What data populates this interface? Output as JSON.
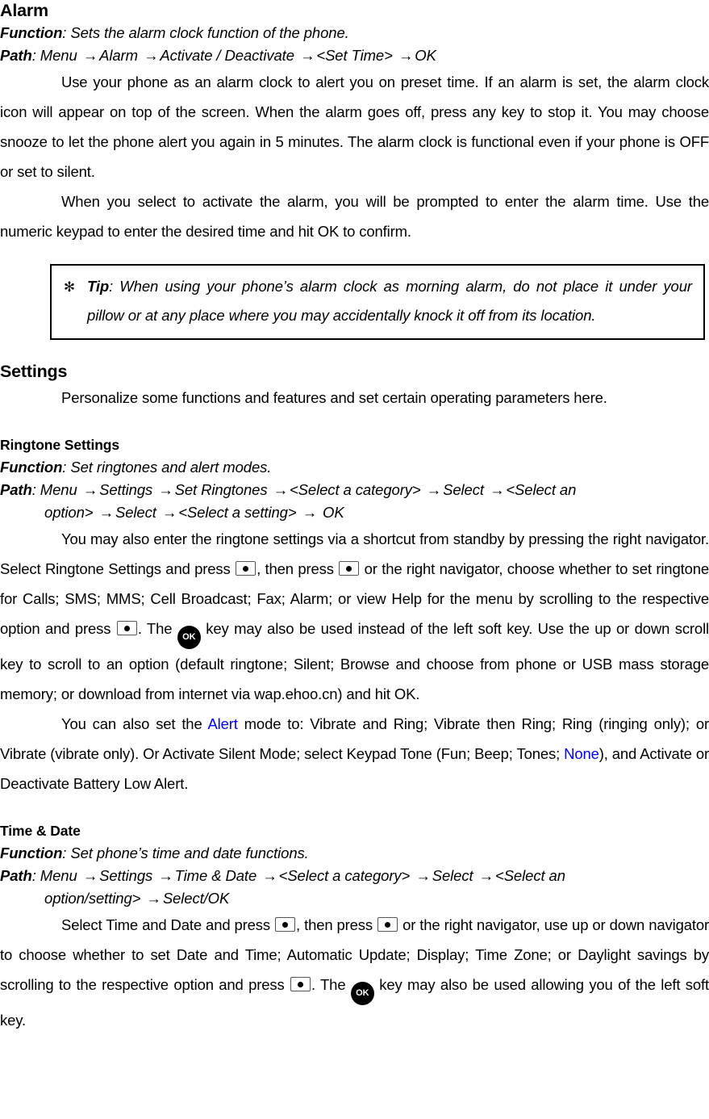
{
  "document": {
    "sections": [
      {
        "id": "alarm",
        "title": "Alarm",
        "function_label": "Function",
        "function_text": ": Sets the alarm clock function of the phone.",
        "path_label": "Path",
        "path_line1_pre": ": Menu ",
        "path_line1": [
          "Alarm ",
          "Activate / Deactivate ",
          "<Set Time> ",
          "OK"
        ],
        "paragraphs": [
          "Use your phone as an alarm clock to alert you on preset time. If an alarm is set, the alarm clock icon will appear on top of the screen. When the alarm goes off, press any key to stop it. You may choose snooze to let the phone alert you again in 5 minutes. The alarm clock is functional even if your phone is OFF or set to silent.",
          "When you select to activate the alarm, you will be prompted to enter the alarm time. Use the numeric keypad to enter the desired time and hit OK to confirm."
        ]
      }
    ],
    "tip": {
      "icon_name": "club-tip-icon",
      "icon_glyph": "✻",
      "label": "Tip",
      "text": ": When using your phone’s alarm clock as morning alarm, do not place it under your pillow or at any place where you may accidentally knock it off from its location."
    },
    "settings": {
      "title": "Settings",
      "intro": "Personalize some functions and features and set certain operating parameters here."
    },
    "ringtone": {
      "title": "Ringtone Settings",
      "function_label": "Function",
      "function_text": ": Set ringtones and alert modes.",
      "path_label": "Path",
      "path_line1_pre": ": Menu ",
      "path_line1": [
        "Settings ",
        "Set Ringtones ",
        "<Select a category> ",
        "Select ",
        "<Select an"
      ],
      "path_line2_pre": "option> ",
      "path_line2": [
        "Select ",
        "<Select a setting> ",
        "  OK"
      ],
      "para1_a": "You may also enter the ringtone settings via a shortcut from standby by pressing the right navigator. Select Ringtone Settings and press ",
      "para1_b": ", then press ",
      "para1_c": " or the right navigator, choose whether to set ringtone for Calls; SMS; MMS; Cell Broadcast; Fax; Alarm; or view Help for the menu by scrolling to the respective option and press ",
      "para1_d": ". The ",
      "para1_e": " key may also be used instead of the left soft key. Use the up or down scroll key to scroll to an option (default ringtone; Silent; Browse and choose from phone or USB mass storage memory; or download from internet via wap.ehoo.cn) and hit OK.",
      "para2_a": "You can also set the ",
      "para2_highlight1": "Alert",
      "para2_b": " mode to: Vibrate and Ring; Vibrate then Ring; Ring (ringing only); or Vibrate (vibrate only). Or Activate Silent Mode; select Keypad Tone (Fun; Beep; Tones; ",
      "para2_highlight2": "None",
      "para2_c": "), and Activate or Deactivate Battery Low Alert."
    },
    "timedate": {
      "title": "Time & Date",
      "function_label": "Function",
      "function_text": ": Set phone’s time and date functions.",
      "path_label": "Path",
      "path_line1_pre": ": Menu ",
      "path_line1": [
        "Settings ",
        "Time & Date ",
        "<Select a category> ",
        "Select ",
        "<Select an"
      ],
      "path_line2_pre": "option/setting> ",
      "path_line2": [
        "Select/OK"
      ],
      "para1_a": "Select Time and Date and press ",
      "para1_b": ", then press ",
      "para1_c": " or the right navigator, use up or down navigator to choose whether to set Date and Time; Automatic Update; Display; Time Zone; or Daylight savings by scrolling to the respective option and press ",
      "para1_d": ". The ",
      "para1_e": " key may also be used allowing you of the left soft key."
    },
    "glyphs": {
      "arrow": "→",
      "ok_key_label": "OK"
    },
    "colors": {
      "highlight": "#0000ff",
      "text": "#000000",
      "background": "#ffffff"
    }
  }
}
